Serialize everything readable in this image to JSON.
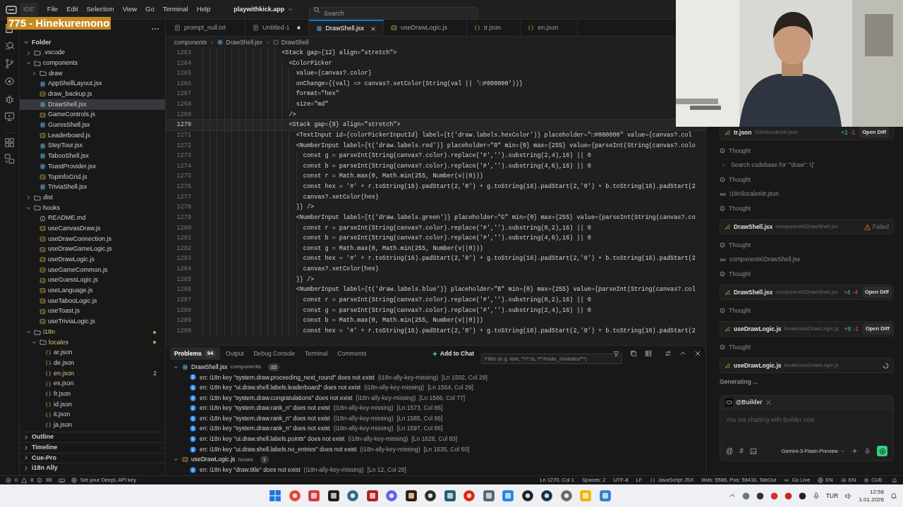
{
  "overlay": {
    "text": "775 - Hinekuremono"
  },
  "title_bar": {
    "app_label": "IDE",
    "menu": [
      "File",
      "Edit",
      "Selection",
      "View",
      "Go",
      "Terminal",
      "Help"
    ],
    "project": "playwithkick.app",
    "search": {
      "placeholder": "Search"
    }
  },
  "explorer": {
    "root": {
      "label": "Folder",
      "expanded": true,
      "children": [
        {
          "label": ".vscode",
          "kind": "folder",
          "expanded": false,
          "selected": false,
          "modified": false
        },
        {
          "label": "components",
          "kind": "folder",
          "expanded": true,
          "selected": false,
          "modified": false,
          "children": [
            {
              "label": "draw",
              "kind": "folder",
              "expanded": false,
              "selected": false,
              "modified": false
            },
            {
              "label": "AppShellLayout.jsx",
              "kind": "react",
              "selected": false,
              "modified": false
            },
            {
              "label": "draw_backup.js",
              "kind": "js",
              "selected": false,
              "modified": false
            },
            {
              "label": "DrawShell.jsx",
              "kind": "react",
              "selected": true,
              "modified": false
            },
            {
              "label": "GameControls.js",
              "kind": "js",
              "selected": false,
              "modified": false
            },
            {
              "label": "GuessShell.jsx",
              "kind": "react",
              "selected": false,
              "modified": false
            },
            {
              "label": "Leaderboard.js",
              "kind": "js",
              "selected": false,
              "modified": false
            },
            {
              "label": "StepTour.jsx",
              "kind": "react",
              "selected": false,
              "modified": false
            },
            {
              "label": "TabooShell.jsx",
              "kind": "react",
              "selected": false,
              "modified": false
            },
            {
              "label": "ToastProvider.jsx",
              "kind": "react",
              "selected": false,
              "modified": false
            },
            {
              "label": "TopInfoGrid.js",
              "kind": "js",
              "selected": false,
              "modified": false
            },
            {
              "label": "TriviaShell.jsx",
              "kind": "react",
              "selected": false,
              "modified": false
            }
          ]
        },
        {
          "label": "dist",
          "kind": "folder",
          "expanded": false,
          "selected": false,
          "modified": false
        },
        {
          "label": "hooks",
          "kind": "folder",
          "expanded": true,
          "selected": false,
          "modified": false,
          "children": [
            {
              "label": "README.md",
              "kind": "info",
              "selected": false,
              "modified": false
            },
            {
              "label": "useCanvasDraw.js",
              "kind": "js",
              "selected": false,
              "modified": false
            },
            {
              "label": "useDrawConnection.js",
              "kind": "js",
              "selected": false,
              "modified": false
            },
            {
              "label": "useDrawGameLogic.js",
              "kind": "js",
              "selected": false,
              "modified": false
            },
            {
              "label": "useDrawLogic.js",
              "kind": "js",
              "selected": false,
              "modified": false
            },
            {
              "label": "useGameCommon.js",
              "kind": "js",
              "selected": false,
              "modified": false
            },
            {
              "label": "useGuessLogic.js",
              "kind": "js",
              "selected": false,
              "modified": false
            },
            {
              "label": "useLanguage.js",
              "kind": "js",
              "selected": false,
              "modified": false
            },
            {
              "label": "useTabooLogic.js",
              "kind": "js",
              "selected": false,
              "modified": false
            },
            {
              "label": "useToast.js",
              "kind": "js",
              "selected": false,
              "modified": false
            },
            {
              "label": "useTriviaLogic.js",
              "kind": "js",
              "selected": false,
              "modified": false
            }
          ]
        },
        {
          "label": "i18n",
          "kind": "folder",
          "expanded": true,
          "selected": false,
          "modified": true,
          "children": [
            {
              "label": "locales",
              "kind": "folder",
              "expanded": true,
              "selected": false,
              "modified": true,
              "children": [
                {
                  "label": "ar.json",
                  "kind": "json",
                  "selected": false,
                  "modified": false
                },
                {
                  "label": "de.json",
                  "kind": "json",
                  "selected": false,
                  "modified": false
                },
                {
                  "label": "en.json",
                  "kind": "json",
                  "selected": false,
                  "modified": true,
                  "badge": "2"
                },
                {
                  "label": "es.json",
                  "kind": "json",
                  "selected": false,
                  "modified": false
                },
                {
                  "label": "fr.json",
                  "kind": "json",
                  "selected": false,
                  "modified": false
                },
                {
                  "label": "id.json",
                  "kind": "json",
                  "selected": false,
                  "modified": false
                },
                {
                  "label": "it.json",
                  "kind": "json",
                  "selected": false,
                  "modified": false
                },
                {
                  "label": "ja.json",
                  "kind": "json",
                  "selected": false,
                  "modified": false
                }
              ]
            }
          ]
        }
      ]
    },
    "sections": [
      {
        "label": "Outline",
        "expanded": false
      },
      {
        "label": "Timeline",
        "expanded": false
      },
      {
        "label": "Cue-Pro",
        "expanded": false
      },
      {
        "label": "i18n Ally",
        "expanded": false
      }
    ]
  },
  "editor": {
    "tabs": [
      {
        "label": "prompt_null.txt",
        "kind": "text",
        "selected": false,
        "modified": false
      },
      {
        "label": "Untitled-1",
        "kind": "text",
        "selected": false,
        "modified": true
      },
      {
        "label": "DrawShell.jsx",
        "kind": "react",
        "selected": true,
        "modified": false
      },
      {
        "label": "useDrawLogic.js",
        "kind": "js",
        "selected": false,
        "modified": false
      },
      {
        "label": "tr.json",
        "kind": "json",
        "selected": false,
        "modified": false
      },
      {
        "label": "en.json",
        "kind": "json",
        "selected": false,
        "modified": false
      }
    ],
    "breadcrumb": [
      "components",
      "DrawShell.jsx",
      "DrawShell"
    ],
    "lines": [
      {
        "number": "1263",
        "current": false,
        "text": "                      <Stack gap={12} align=\"stretch\">"
      },
      {
        "number": "1264",
        "current": false,
        "text": "                        <ColorPicker"
      },
      {
        "number": "1265",
        "current": false,
        "text": "                          value={canvas?.color}"
      },
      {
        "number": "1266",
        "current": false,
        "text": "                          onChange={(val) => canvas?.setColor(String(val || '□#000000'))}"
      },
      {
        "number": "1267",
        "current": false,
        "text": "                          format=\"hex\""
      },
      {
        "number": "1268",
        "current": false,
        "text": "                          size=\"md\""
      },
      {
        "number": "1269",
        "current": false,
        "text": "                        />"
      },
      {
        "number": "1270",
        "current": true,
        "text": "                        <Stack gap={8} align=\"stretch\">"
      },
      {
        "number": "1271",
        "current": false,
        "text": "                          <TextInput id={colorPickerInputId} label={t('draw.labels.hexColor')} placeholder=\"□#000000\" value={canvas?.col"
      },
      {
        "number": "1272",
        "current": false,
        "text": "                          <NumberInput label={t('draw.labels.red')} placeholder=\"R\" min={0} max={255} value={parseInt(String(canvas?.colo"
      },
      {
        "number": "1273",
        "current": false,
        "text": "                            const g = parseInt(String(canvas?.color).replace('#','').substring(2,4),16) || 0"
      },
      {
        "number": "1274",
        "current": false,
        "text": "                            const b = parseInt(String(canvas?.color).replace('#','').substring(4,6),16) || 0"
      },
      {
        "number": "1275",
        "current": false,
        "text": "                            const r = Math.max(0, Math.min(255, Number(v||0)))"
      },
      {
        "number": "1276",
        "current": false,
        "text": "                            const hex = '#' + r.toString(16).padStart(2,'0') + g.toString(16).padStart(2,'0') + b.toString(16).padStart(2"
      },
      {
        "number": "1277",
        "current": false,
        "text": "                            canvas?.setColor(hex)"
      },
      {
        "number": "1278",
        "current": false,
        "text": "                          }} />"
      },
      {
        "number": "1279",
        "current": false,
        "text": "                          <NumberInput label={t('draw.labels.green')} placeholder=\"G\" min={0} max={255} value={parseInt(String(canvas?.co"
      },
      {
        "number": "1280",
        "current": false,
        "text": "                            const r = parseInt(String(canvas?.color).replace('#','').substring(0,2),16) || 0"
      },
      {
        "number": "1281",
        "current": false,
        "text": "                            const b = parseInt(String(canvas?.color).replace('#','').substring(4,6),16) || 0"
      },
      {
        "number": "1282",
        "current": false,
        "text": "                            const g = Math.max(0, Math.min(255, Number(v||0)))"
      },
      {
        "number": "1283",
        "current": false,
        "text": "                            const hex = '#' + r.toString(16).padStart(2,'0') + g.toString(16).padStart(2,'0') + b.toString(16).padStart(2"
      },
      {
        "number": "1284",
        "current": false,
        "text": "                            canvas?.setColor(hex)"
      },
      {
        "number": "1285",
        "current": false,
        "text": "                          }} />"
      },
      {
        "number": "1286",
        "current": false,
        "text": "                          <NumberInput label={t('draw.labels.blue')} placeholder=\"B\" min={0} max={255} value={parseInt(String(canvas?.col"
      },
      {
        "number": "1287",
        "current": false,
        "text": "                            const r = parseInt(String(canvas?.color).replace('#','').substring(0,2),16) || 0"
      },
      {
        "number": "1288",
        "current": false,
        "text": "                            const g = parseInt(String(canvas?.color).replace('#','').substring(2,4),16) || 0"
      },
      {
        "number": "1289",
        "current": false,
        "text": "                            const b = Math.max(0, Math.min(255, Number(v||0)))"
      },
      {
        "number": "1290",
        "current": false,
        "text": "                            const hex = '#' + r.toString(16).padStart(2,'0') + g.toString(16).padStart(2,'0') + b.toString(16).padStart(2"
      }
    ]
  },
  "panel": {
    "tabs": [
      {
        "label": "Problems",
        "badge": "94",
        "selected": true
      },
      {
        "label": "Output",
        "selected": false
      },
      {
        "label": "Debug Console",
        "selected": false
      },
      {
        "label": "Terminal",
        "selected": false
      },
      {
        "label": "Comments",
        "selected": false
      }
    ],
    "add_to_chat": "Add to Chat",
    "filter": {
      "placeholder": "Filter (e.g. text, **/*.ts, !**/node_modules/**)"
    },
    "groups": [
      {
        "file": "DrawShell.jsx",
        "kind": "react",
        "folder": "components",
        "count": "85",
        "expanded": true,
        "problems": [
          {
            "message": "en: i18n key \"system.draw.proceeding_next_round\" does not exist",
            "source": "(i18n-ally-key-missing)",
            "location": "[Ln 1502, Col 29]"
          },
          {
            "message": "en: i18n key \"ui.draw.shell.labels.leaderboard\" does not exist",
            "source": "(i18n-ally-key-missing)",
            "location": "[Ln 1564, Col 29]"
          },
          {
            "message": "en: i18n key \"system.draw.congratulations\" does not exist",
            "source": "(i18n-ally-key-missing)",
            "location": "[Ln 1566, Col 77]"
          },
          {
            "message": "en: i18n key \"system.draw.rank_n\" does not exist",
            "source": "(i18n-ally-key-missing)",
            "location": "[Ln 1573, Col 86]"
          },
          {
            "message": "en: i18n key \"system.draw.rank_n\" does not exist",
            "source": "(i18n-ally-key-missing)",
            "location": "[Ln 1585, Col 86]"
          },
          {
            "message": "en: i18n key \"system.draw.rank_n\" does not exist",
            "source": "(i18n-ally-key-missing)",
            "location": "[Ln 1597, Col 86]"
          },
          {
            "message": "en: i18n key \"ui.draw.shell.labels.points\" does not exist",
            "source": "(i18n-ally-key-missing)",
            "location": "[Ln 1628, Col 83]"
          },
          {
            "message": "en: i18n key \"ui.draw.shell.labels.no_entries\" does not exist",
            "source": "(i18n-ally-key-missing)",
            "location": "[Ln 1635, Col 60]"
          }
        ]
      },
      {
        "file": "useDrawLogic.js",
        "kind": "js",
        "folder": "hooks",
        "count": "1",
        "expanded": true,
        "problems": [
          {
            "message": "en: i18n key \"draw.title\" does not exist",
            "source": "(i18n-ally-key-missing)",
            "location": "[Ln 12, Col 28]"
          }
        ]
      }
    ]
  },
  "chat": {
    "items": [
      {
        "kind": "diff",
        "file": "tr.json",
        "path": "i18n\\locales\\tr.json",
        "added": "+2",
        "removed": "-1",
        "action": "Open Diff"
      },
      {
        "kind": "thought",
        "text": "Thought"
      },
      {
        "kind": "search",
        "text": "Search codebase for '\"draw\": \\{'"
      },
      {
        "kind": "thought",
        "text": "Thought"
      },
      {
        "kind": "read",
        "text": "i18n\\locales\\tr.json"
      },
      {
        "kind": "thought",
        "text": "Thought"
      },
      {
        "kind": "failed",
        "file": "DrawShell.jsx",
        "path": "components\\DrawShell.jsx",
        "status_text": "Failed"
      },
      {
        "kind": "thought",
        "text": "Thought"
      },
      {
        "kind": "read",
        "text": "components\\DrawShell.jsx"
      },
      {
        "kind": "thought",
        "text": "Thought"
      },
      {
        "kind": "diff",
        "file": "DrawShell.jsx",
        "path": "components\\DrawShell.jsx",
        "added": "+4",
        "removed": "-4",
        "action": "Open Diff"
      },
      {
        "kind": "thought",
        "text": "Thought"
      },
      {
        "kind": "diff",
        "file": "useDrawLogic.js",
        "path": "hooks\\useDrawLogic.js",
        "added": "+8",
        "removed": "-1",
        "action": "Open Diff"
      },
      {
        "kind": "thought",
        "text": "Thought"
      },
      {
        "kind": "pending",
        "file": "useDrawLogic.js",
        "path": "hooks\\useDrawLogic.js"
      }
    ],
    "status": "Generating ...",
    "composer": {
      "agent": "@Builder",
      "placeholder": "You are chatting with Builder now",
      "quick_buttons": [
        "@",
        "#"
      ],
      "model": "Gemini-3-Flash-Preview"
    }
  },
  "status_bar": {
    "errors": "0",
    "warnings": "8",
    "infos": "86",
    "deepl": "Set your DeepL API key",
    "right": [
      {
        "text": "Ln 1270, Col 1",
        "kind": "plain"
      },
      {
        "text": "Spaces: 2",
        "kind": "plain"
      },
      {
        "text": "UTF-8",
        "kind": "plain"
      },
      {
        "text": "LF",
        "kind": "plain"
      },
      {
        "text": "JavaScript JSX",
        "kind": "language"
      },
      {
        "text": "Wds: 5586, Pos: 59416, TabOut",
        "kind": "plain"
      },
      {
        "text": "Go Live",
        "kind": "live"
      },
      {
        "text": "EN",
        "kind": "globe"
      },
      {
        "text": "EN",
        "kind": "eye"
      },
      {
        "text": "CUE",
        "kind": "cue"
      }
    ]
  },
  "taskbar": {
    "language": "TUR",
    "time": "12:58",
    "date": "1.01.2026"
  }
}
